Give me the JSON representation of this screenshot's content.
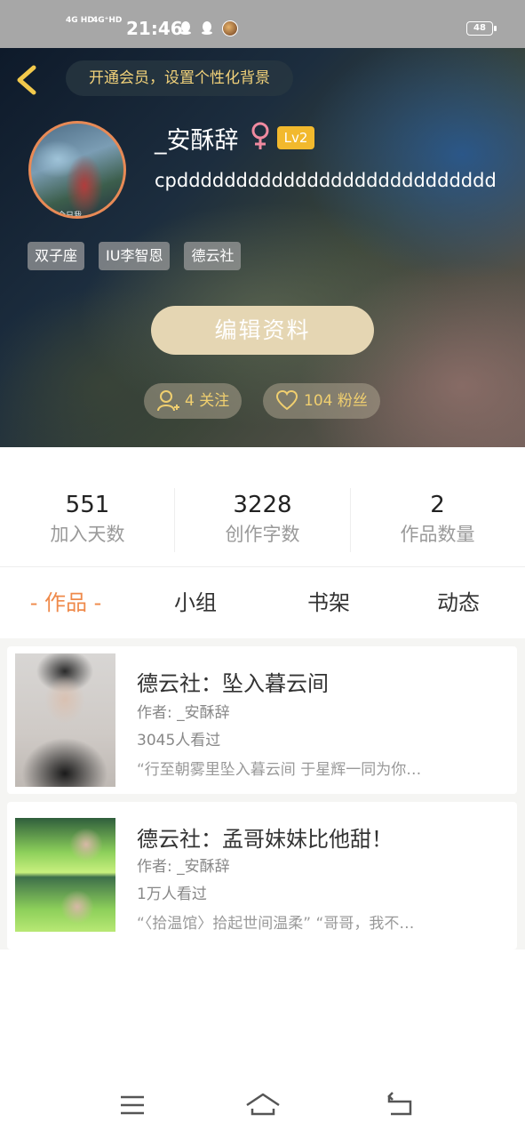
{
  "status_bar": {
    "signal_1": "4G HD",
    "signal_2": "4G⁺HD",
    "time": "21:46",
    "battery": "48"
  },
  "header": {
    "vip_prompt": "开通会员，设置个性化背景",
    "username": "_安酥辞",
    "level": "Lv2",
    "bio": "cpddddddddddddddddddddddddddd",
    "avatar_watermark": "今日我...",
    "tags": [
      "双子座",
      "IU李智恩",
      "德云社"
    ],
    "edit_button": "编辑资料",
    "following": "4 关注",
    "followers": "104 粉丝"
  },
  "stats": [
    {
      "value": "551",
      "label": "加入天数"
    },
    {
      "value": "3228",
      "label": "创作字数"
    },
    {
      "value": "2",
      "label": "作品数量"
    }
  ],
  "tabs": [
    "- 作品 -",
    "小组",
    "书架",
    "动态"
  ],
  "works": [
    {
      "title": "德云社：坠入暮云间",
      "author": "作者: _安酥辞",
      "views": "3045人看过",
      "intro": "“行至朝雾里坠入暮云间 于星辉一同为你…"
    },
    {
      "title": "德云社：孟哥妹妹比他甜！",
      "author": "作者: _安酥辞",
      "views": "1万人看过",
      "intro": "“〈拾温馆〉拾起世间温柔”  “哥哥，我不…"
    }
  ],
  "colors": {
    "accent": "#ef8a4b",
    "gold": "#f0cf6f",
    "level_badge": "#f2b92d",
    "edit_button": "#e5d6b3"
  },
  "icons": {
    "back": "chevron-left-icon",
    "gender": "female-icon",
    "following": "person-add-icon",
    "followers": "heart-icon",
    "menu": "menu-icon",
    "home": "home-icon",
    "back_nav": "back-arrow-icon"
  }
}
